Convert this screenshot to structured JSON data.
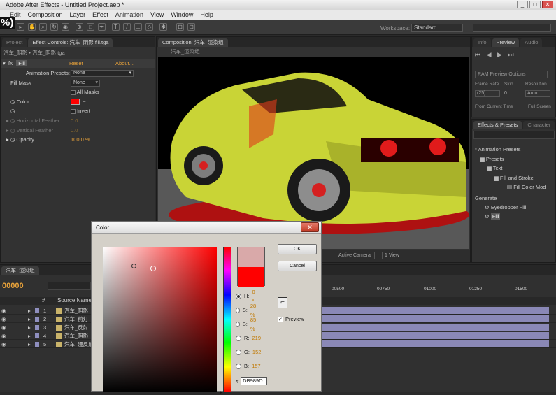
{
  "window": {
    "title": "Adobe After Effects - Untitled Project.aep *",
    "controls": [
      "_",
      "□",
      "✕"
    ]
  },
  "menu": [
    "Edit",
    "Composition",
    "Layer",
    "Effect",
    "Animation",
    "View",
    "Window",
    "Help"
  ],
  "overlay": {
    "zoom_fragment": "%)"
  },
  "toolbar": {
    "workspace_label": "Workspace:",
    "workspace_value": "Standard"
  },
  "effect_controls": {
    "tabs": [
      "Project",
      "Effect Controls: 汽车_阴影 fill.tga"
    ],
    "breadcrumb": "汽车_阴影 • 汽车_阴影 tga",
    "effect_name": "Fill",
    "reset_label": "Reset",
    "about_label": "About...",
    "animation_presets_label": "Animation Presets:",
    "animation_presets_value": "None",
    "fill_mask_label": "Fill Mask",
    "fill_mask_value": "None",
    "all_masks_label": "All Masks",
    "color_label": "Color",
    "color_value": "#ff0000",
    "invert_label": "Invert",
    "h_feather_label": "Horizontal Feather",
    "h_feather_value": "0.0",
    "v_feather_label": "Vertical Feather",
    "v_feather_value": "0.0",
    "opacity_label": "Opacity",
    "opacity_value": "100.0 %"
  },
  "composition": {
    "tab": "Composition: 汽车_渲染组",
    "subtab": "汽车_渲染组",
    "active_camera": "Active Camera",
    "view": "1 View"
  },
  "info_panel": {
    "tabs": [
      "Info",
      "Preview",
      "Audio"
    ],
    "ram_options": "RAM Preview Options",
    "frame_rate_label": "Frame Rate",
    "skip_label": "Skip",
    "resolution_label": "Resolution",
    "frame_rate_value": "(25)",
    "skip_value": "0",
    "resolution_value": "Auto",
    "from_current_label": "From Current Time",
    "full_screen_label": "Full Screen"
  },
  "effects_presets": {
    "tabs": [
      "Effects & Presets",
      "Character"
    ],
    "tree": [
      "* Animation Presets",
      "Presets",
      "Text",
      "Fill and Stroke",
      "Fill Color Mod",
      "Generate",
      "Eyedropper Fill",
      "Fill"
    ]
  },
  "timeline": {
    "tab": "汽车_渲染组",
    "timecode": "00000",
    "columns": [
      "#",
      "Source Name"
    ],
    "layers": [
      {
        "num": "1",
        "name": "汽车_阴影"
      },
      {
        "num": "2",
        "name": "汽车_前灯"
      },
      {
        "num": "3",
        "name": "汽车_反射"
      },
      {
        "num": "4",
        "name": "汽车_阴影"
      },
      {
        "num": "5",
        "name": "汽车_漫反射"
      }
    ],
    "ruler": [
      "00500",
      "00750",
      "01000",
      "01250",
      "01500"
    ]
  },
  "color_dialog": {
    "title": "Color",
    "ok": "OK",
    "cancel": "Cancel",
    "preview_label": "Preview",
    "fields": [
      {
        "label": "H:",
        "value": "0 °",
        "selected": true
      },
      {
        "label": "S:",
        "value": "28 %",
        "selected": false
      },
      {
        "label": "B:",
        "value": "85 %",
        "selected": false
      },
      {
        "label": "R:",
        "value": "219",
        "selected": false
      },
      {
        "label": "G:",
        "value": "152",
        "selected": false
      },
      {
        "label": "B:",
        "value": "157",
        "selected": false
      }
    ],
    "hex_label": "#",
    "hex_value": "DB989D",
    "new_color": "#d9a9a9",
    "old_color": "#ff0000"
  }
}
